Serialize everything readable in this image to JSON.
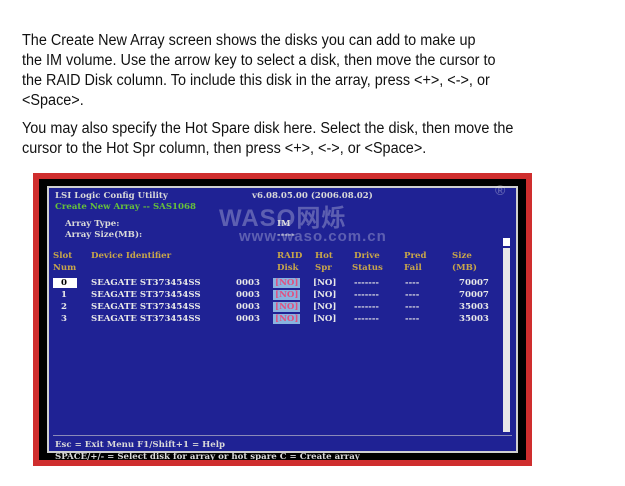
{
  "intro": {
    "lines": [
      "The Create New Array screen shows the disks you can add to make up",
      "the IM volume. Use the arrow key to select a disk, then move the cursor to",
      "the RAID Disk column. To include this disk in the array, press <+>, <->, or",
      "<Space>."
    ]
  },
  "hotspare": {
    "lines": [
      "You may also specify the Hot Spare disk here. Select the disk, then move the",
      "cursor to the Hot Spr column, then press <+>, <->, or <Space>."
    ]
  },
  "utility": {
    "title": "LSI Logic Config Utility",
    "version": "v6.08.05.00 (2006.08.02)",
    "subtitle": "Create New Array -- SAS1068",
    "array_type_label": "Array Type:",
    "array_type_value": "IM",
    "array_size_label": "Array Size(MB):",
    "array_size_value": "-----"
  },
  "watermark": {
    "brand": "WASO网烁",
    "url": "www.waso.com.cn",
    "reg": "®"
  },
  "table": {
    "headers_row1": {
      "slot": "Slot",
      "device": "Device Identifier",
      "raid": "RAID",
      "hot": "Hot",
      "drive": "Drive",
      "pred": "Pred",
      "size": "Size"
    },
    "headers_row2": {
      "slot": "Num",
      "raid": "Disk",
      "hot": "Spr",
      "drive": "Status",
      "pred": "Fail",
      "size": "(MB)"
    },
    "rows": [
      {
        "slot": "0",
        "device": "SEAGATE ST373454SS",
        "rev": "0003",
        "raid": "[NO]",
        "hot": "[NO]",
        "status": "-------",
        "pred": "----",
        "size": "70007"
      },
      {
        "slot": "1",
        "device": "SEAGATE ST373454SS",
        "rev": "0003",
        "raid": "[NO]",
        "hot": "[NO]",
        "status": "-------",
        "pred": "----",
        "size": "70007"
      },
      {
        "slot": "2",
        "device": "SEAGATE ST373454SS",
        "rev": "0003",
        "raid": "[NO]",
        "hot": "[NO]",
        "status": "-------",
        "pred": "----",
        "size": "35003"
      },
      {
        "slot": "3",
        "device": "SEAGATE ST373454SS",
        "rev": "0003",
        "raid": "[NO]",
        "hot": "[NO]",
        "status": "-------",
        "pred": "----",
        "size": "35003"
      }
    ]
  },
  "footer": {
    "line1": "Esc = Exit Menu     F1/Shift+1 = Help",
    "line2": "SPACE/+/- = Select disk for array or hot spare   C = Create array"
  },
  "colors": {
    "screen_bg": "#1f2294",
    "frame": "#cf2e2e",
    "highlight": "#89b3df",
    "no_text": "#e05080",
    "subtitle": "#67c23a"
  }
}
